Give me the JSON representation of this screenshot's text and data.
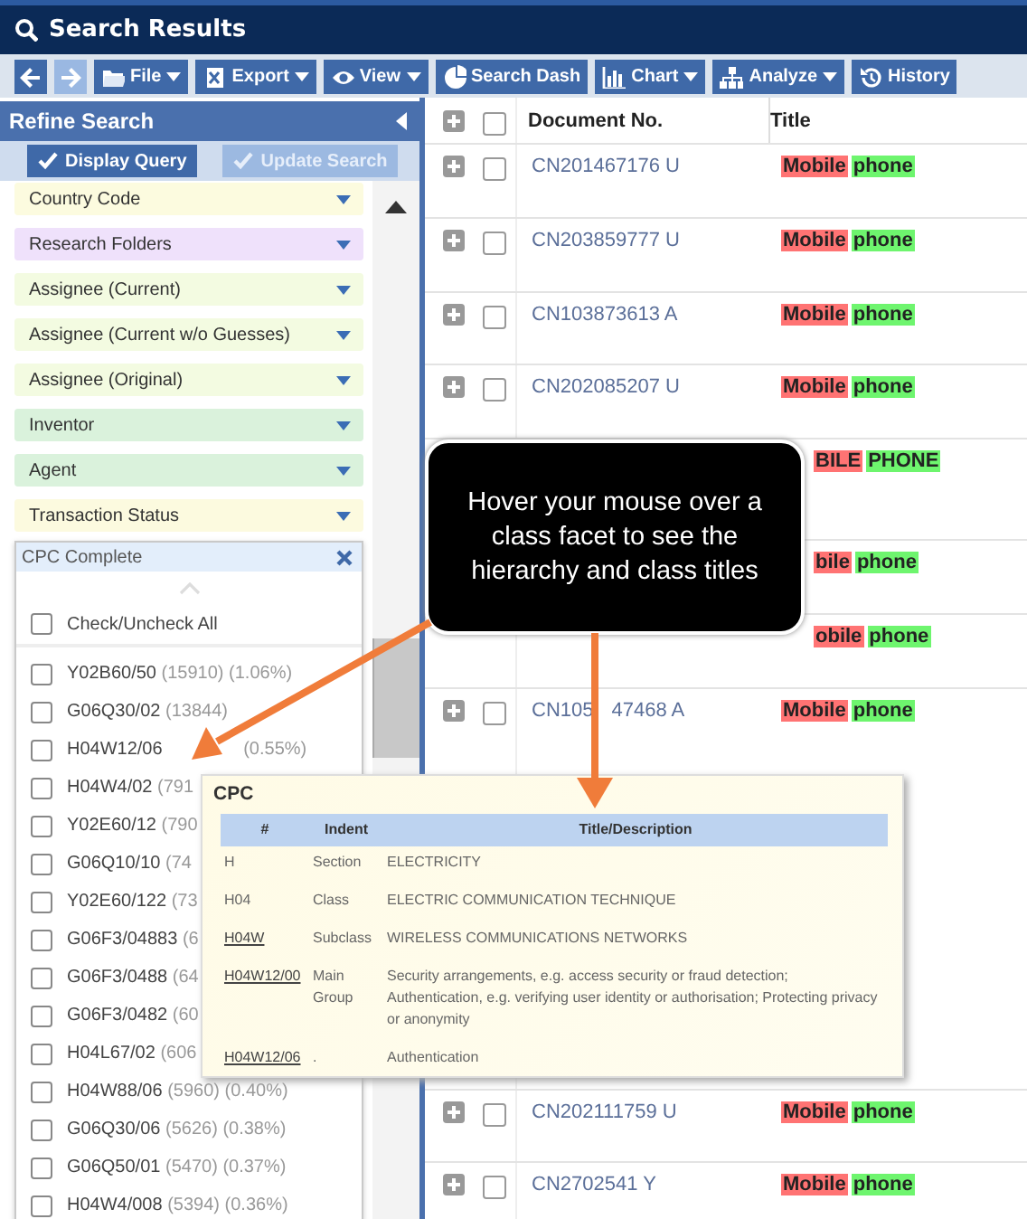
{
  "window": {
    "title": "Search Results"
  },
  "toolbar": [
    {
      "kind": "back",
      "disabled": false
    },
    {
      "kind": "forward",
      "disabled": true
    },
    {
      "kind": "folder",
      "label": "File",
      "dropdown": true
    },
    {
      "kind": "sheet",
      "label": "Export",
      "dropdown": true
    },
    {
      "kind": "eye",
      "label": "View",
      "dropdown": true
    },
    {
      "kind": "pie",
      "label": "Search Dash",
      "dropdown": false
    },
    {
      "kind": "bars",
      "label": "Chart",
      "dropdown": true
    },
    {
      "kind": "tree",
      "label": "Analyze",
      "dropdown": true
    },
    {
      "kind": "history",
      "label": "History",
      "dropdown": false
    }
  ],
  "sidebar": {
    "title": "Refine Search",
    "buttons": [
      {
        "label": "Display Query",
        "disabled": false
      },
      {
        "label": "Update Search",
        "disabled": true
      }
    ],
    "facets": [
      {
        "label": "Country Code",
        "color": "#fcfbdf"
      },
      {
        "label": "Research Folders",
        "color": "#efe1fb"
      },
      {
        "label": "Assignee (Current)",
        "color": "#f3fbe1"
      },
      {
        "label": "Assignee (Current w/o Guesses)",
        "color": "#f3fbe1"
      },
      {
        "label": "Assignee (Original)",
        "color": "#f3fbe1"
      },
      {
        "label": "Inventor",
        "color": "#daf2dc"
      },
      {
        "label": "Agent",
        "color": "#daf2dc"
      },
      {
        "label": "Transaction Status",
        "color": "#fcfadf"
      }
    ],
    "cpc_panel": {
      "title": "CPC Complete",
      "check_all": {
        "label": "Check/Uncheck All",
        "checked": false
      },
      "items": [
        {
          "code": "Y02B60/50",
          "count": "(15910)",
          "share": "(1.06%)",
          "checked": false
        },
        {
          "code": "G06Q30/02",
          "count": "(13844)",
          "checked": false
        },
        {
          "code": "H04W12/06",
          "share": "(0.55%)",
          "checked": false
        },
        {
          "code": "H04W4/02",
          "count": "(791",
          "checked": false
        },
        {
          "code": "Y02E60/12",
          "count": "(790",
          "checked": false
        },
        {
          "code": "G06Q10/10",
          "count": "(74",
          "checked": false
        },
        {
          "code": "Y02E60/122",
          "count": "(73",
          "checked": false
        },
        {
          "code": "G06F3/04883",
          "count": "(6",
          "checked": false
        },
        {
          "code": "G06F3/0488",
          "count": "(64",
          "checked": false
        },
        {
          "code": "G06F3/0482",
          "count": "(60",
          "checked": false
        },
        {
          "code": "H04L67/02",
          "count": "(606",
          "checked": false
        },
        {
          "code": "H04W88/06",
          "count": "(5960)",
          "share": "(0.40%)",
          "checked": false
        },
        {
          "code": "G06Q30/06",
          "count": "(5626)",
          "share": "(0.38%)",
          "checked": false
        },
        {
          "code": "G06Q50/01",
          "count": "(5470)",
          "share": "(0.37%)",
          "checked": false
        },
        {
          "code": "H04W4/008",
          "count": "(5394)",
          "share": "(0.36%)",
          "checked": false
        }
      ]
    }
  },
  "table": {
    "columns": [
      "Document No.",
      "Title"
    ],
    "all_checked": false,
    "rows": [
      {
        "kind": "full",
        "checked": false,
        "document_number": "CN201467176 U",
        "title": [
          {
            "text": "Mobile",
            "color": "#ff7373"
          },
          {
            "text": "phone",
            "color": "#6ef56e"
          }
        ]
      },
      {
        "kind": "full",
        "checked": false,
        "document_number": "CN203859777 U",
        "title": [
          {
            "text": "Mobile",
            "color": "#ff7373"
          },
          {
            "text": "phone",
            "color": "#6ef56e"
          }
        ]
      },
      {
        "kind": "full",
        "checked": false,
        "document_number": "CN103873613 A",
        "title": [
          {
            "text": "Mobile",
            "color": "#ff7373"
          },
          {
            "text": "phone",
            "color": "#6ef56e"
          }
        ]
      },
      {
        "kind": "full",
        "checked": false,
        "document_number": "CN202085207 U",
        "title": [
          {
            "text": "Mobile",
            "color": "#ff7373"
          },
          {
            "text": "phone",
            "color": "#6ef56e"
          }
        ]
      },
      {
        "kind": "partial",
        "title": [
          {
            "text": "BILE",
            "color": "#ff7373"
          },
          {
            "text": "PHONE",
            "color": "#6ef56e"
          }
        ]
      },
      {
        "kind": "partial",
        "title": [
          {
            "text": "bile",
            "color": "#ff7373"
          },
          {
            "text": "phone",
            "color": "#6ef56e"
          }
        ]
      },
      {
        "kind": "partial",
        "title": [
          {
            "text": "obile",
            "color": "#ff7373"
          },
          {
            "text": "phone",
            "color": "#6ef56e"
          }
        ]
      },
      {
        "kind": "full",
        "checked": false,
        "document_number": "CN105",
        "document_number_tail": "47468 A",
        "title": [
          {
            "text": "Mobile",
            "color": "#ff7373"
          },
          {
            "text": "phone",
            "color": "#6ef56e"
          }
        ]
      },
      {
        "kind": "full",
        "checked": false,
        "document_number": "CN202111759 U",
        "title": [
          {
            "text": "Mobile",
            "color": "#ff7373"
          },
          {
            "text": "phone",
            "color": "#6ef56e"
          }
        ]
      },
      {
        "kind": "full",
        "checked": false,
        "document_number": "CN2702541 Y",
        "title": [
          {
            "text": "Mobile",
            "color": "#ff7373"
          },
          {
            "text": "phone",
            "color": "#6ef56e"
          }
        ]
      }
    ]
  },
  "popup": {
    "title": "CPC",
    "columns": [
      "#",
      "Indent",
      "Title/Description"
    ],
    "rows": [
      {
        "symbol": "H",
        "indent": "Section",
        "description": "ELECTRICITY",
        "linked": false
      },
      {
        "symbol": "H04",
        "indent": "Class",
        "description": "ELECTRIC COMMUNICATION TECHNIQUE",
        "linked": false
      },
      {
        "symbol": "H04W",
        "indent": "Subclass",
        "description": "WIRELESS COMMUNICATIONS NETWORKS",
        "linked": true
      },
      {
        "symbol": "H04W12/00",
        "indent": "Main Group",
        "description": "Security arrangements, e.g. access security or fraud detection; Authentication, e.g. verifying user identity or authorisation; Protecting privacy or anonymity",
        "linked": true
      },
      {
        "symbol": "H04W12/06",
        "indent": ".",
        "description": "Authentication",
        "linked": true
      }
    ]
  },
  "callout": {
    "text": "Hover your mouse over a class facet to see the hierarchy and class titles"
  }
}
